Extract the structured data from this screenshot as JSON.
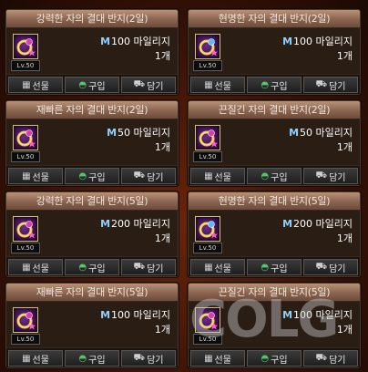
{
  "buttons": {
    "gift": "선물",
    "buy": "구입",
    "cart": "담기"
  },
  "level_label": "Lv.50",
  "currency_icon": "M",
  "items": [
    {
      "name": "강력한 자의 결대 반지(2일)",
      "price": "100 마일리지",
      "qty": "1개",
      "gem": "#e03ab0"
    },
    {
      "name": "현명한 자의 결대 반지(2일)",
      "price": "100 마일리지",
      "qty": "1개",
      "gem": "#5bb8ff"
    },
    {
      "name": "재빠른 자의 결대 반지(2일)",
      "price": "50 마일리지",
      "qty": "1개",
      "gem": "#e03ab0"
    },
    {
      "name": "끈질긴 자의 결대 반지(2일)",
      "price": "50 마일리지",
      "qty": "1개",
      "gem": "#e03ab0"
    },
    {
      "name": "강력한 자의 결대 반지(5일)",
      "price": "200 마일리지",
      "qty": "1개",
      "gem": "#e03ab0"
    },
    {
      "name": "현명한 자의 결대 반지(5일)",
      "price": "200 마일리지",
      "qty": "1개",
      "gem": "#5bb8ff"
    },
    {
      "name": "재빠른 자의 결대 반지(5일)",
      "price": "100 마일리지",
      "qty": "1개",
      "gem": "#e03ab0"
    },
    {
      "name": "끈질긴 자의 결대 반지(5일)",
      "price": "100 마일리지",
      "qty": "1개",
      "gem": "#e03ab0"
    }
  ],
  "watermark": "COLG"
}
